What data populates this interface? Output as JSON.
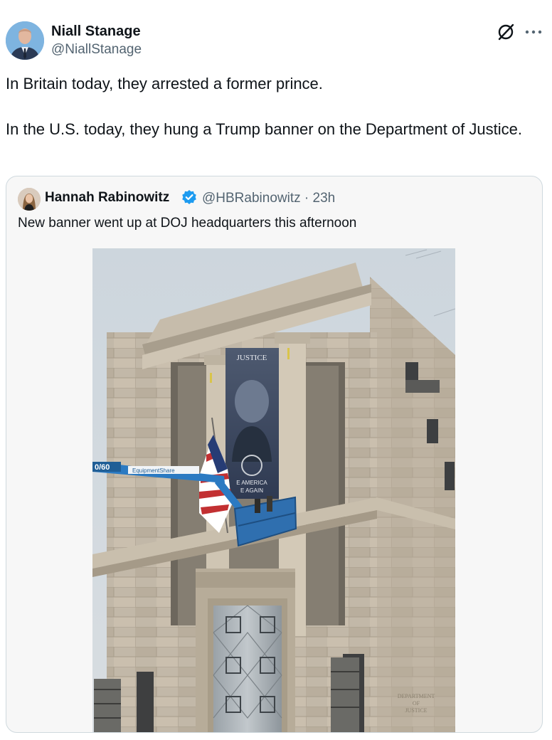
{
  "tweet": {
    "author_name": "Niall Stanage",
    "author_handle": "@NiallStanage",
    "paragraphs": [
      "In Britain today, they arrested a former prince.",
      "In the U.S. today, they hung a Trump banner on the Department of Justice."
    ]
  },
  "quote": {
    "author_name": "Hannah Rabinowitz",
    "author_handle": "@HBRabinowitz",
    "separator": "·",
    "time": "23h",
    "text": "New banner went up at DOJ headquarters this afternoon",
    "photo": {
      "banner_top": "JUSTICE",
      "banner_line1": "E AMERICA",
      "banner_line2": "E AGAIN",
      "lift_number": "0/60",
      "lift_brand": "EquipmentShare",
      "plaque": [
        "DEPARTMENT",
        "OF",
        "JUSTICE"
      ]
    }
  },
  "colors": {
    "text_primary": "#0f1419",
    "text_secondary": "#536471",
    "border": "#cfd9de",
    "quote_bg": "#f7f7f7",
    "verified": "#1d9bf0"
  },
  "icons": {
    "grok": "grok-icon",
    "more": "more-icon",
    "verified": "verified-badge-icon"
  }
}
